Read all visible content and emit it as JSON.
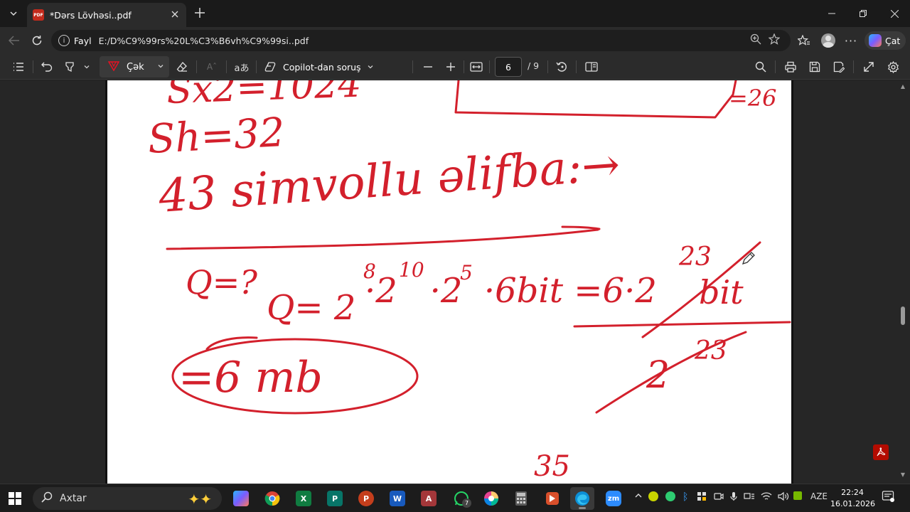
{
  "browser": {
    "tab": {
      "title": "*Dərs Lövhəsi..pdf",
      "badge": "PDF"
    },
    "address": {
      "scheme_label": "Fayl",
      "url": "E:/D%C9%99rs%20L%C3%B6vh%C9%99si..pdf"
    },
    "copilot_label": "Çat"
  },
  "pdf_toolbar": {
    "draw_label": "Çək",
    "read_aloud_label": "aあ",
    "ask_copilot_label": "Copilot-dan soruş",
    "page_current": "6",
    "page_total": "/ 9"
  },
  "document": {
    "handwriting": {
      "line_top_left": "Sx2=1024",
      "line_sh": "Sh=32",
      "line_alphabet": "43 simvollu əlifba:→",
      "side_fraction": "=26",
      "q_question": "Q=?",
      "q_formula_base": "Q= 2",
      "exp_8": "8",
      "exp_10": "10",
      "exp_5": "5",
      "q_formula_mid": "·2   ·2  ·6bit =6·2",
      "exp_23": "23",
      "bit_text": "bit",
      "denominator_base": "2",
      "denominator_exp": "23",
      "answer": "=6 mb",
      "bottom_exp": "35"
    },
    "ink_color": "#d3202c"
  },
  "taskbar": {
    "search_placeholder": "Axtar",
    "language": "AZE",
    "time": "22:24",
    "date": "16.01.2026",
    "whatsapp_badge": "7"
  }
}
